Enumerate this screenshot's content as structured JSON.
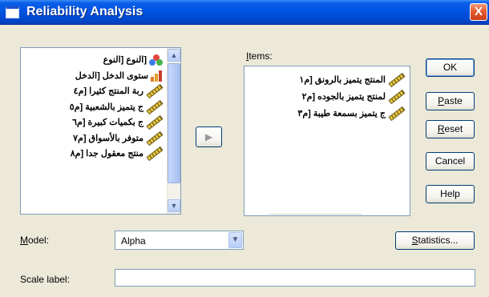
{
  "window": {
    "title": "Reliability Analysis",
    "close_glyph": "X"
  },
  "variables_list": {
    "items": [
      {
        "label": "[النوع [النوع",
        "icon": "nominal-icon"
      },
      {
        "label": "ستوى الدخل [الدخل",
        "icon": "ordinal-icon"
      },
      {
        "label": "ربة المنتج كثيرا [م٤",
        "icon": "scale-ruler-icon"
      },
      {
        "label": "ج يتميز بالشعبية [م٥",
        "icon": "scale-ruler-icon"
      },
      {
        "label": "ج بكميات كبيرة [م٦",
        "icon": "scale-ruler-icon"
      },
      {
        "label": "متوفر بالأسواق [م٧",
        "icon": "scale-ruler-icon"
      },
      {
        "label": "منتج معقول جدا [م٨",
        "icon": "scale-ruler-icon"
      }
    ],
    "scroll_up_glyph": "▲",
    "scroll_down_glyph": "▼"
  },
  "move_button_glyph": "▶",
  "items_list": {
    "label": "Items:",
    "mnemonic": "I",
    "label_rest": "tems:",
    "items": [
      {
        "label": "المنتج يتميز بالرونق [م١",
        "icon": "scale-ruler-icon"
      },
      {
        "label": "لمنتج يتميز بالجوده [م٢",
        "icon": "scale-ruler-icon"
      },
      {
        "label": "ج يتميز بسمعة طيبة [م٣",
        "icon": "scale-ruler-icon"
      }
    ]
  },
  "buttons": {
    "ok": "OK",
    "paste_mn": "P",
    "paste_rest": "aste",
    "reset_mn": "R",
    "reset_rest": "eset",
    "cancel": "Cancel",
    "help": "Help",
    "statistics_mn": "S",
    "statistics_rest": "tatistics..."
  },
  "model": {
    "label_mn": "M",
    "label_rest": "odel:",
    "selected": "Alpha",
    "arrow_glyph": "▼"
  },
  "scale_label": {
    "label": "Scale label:",
    "value": ""
  },
  "colors": {
    "titlebar": "#0054e3",
    "dialog_bg": "#ece9d8",
    "close_button": "#e35a2e"
  }
}
